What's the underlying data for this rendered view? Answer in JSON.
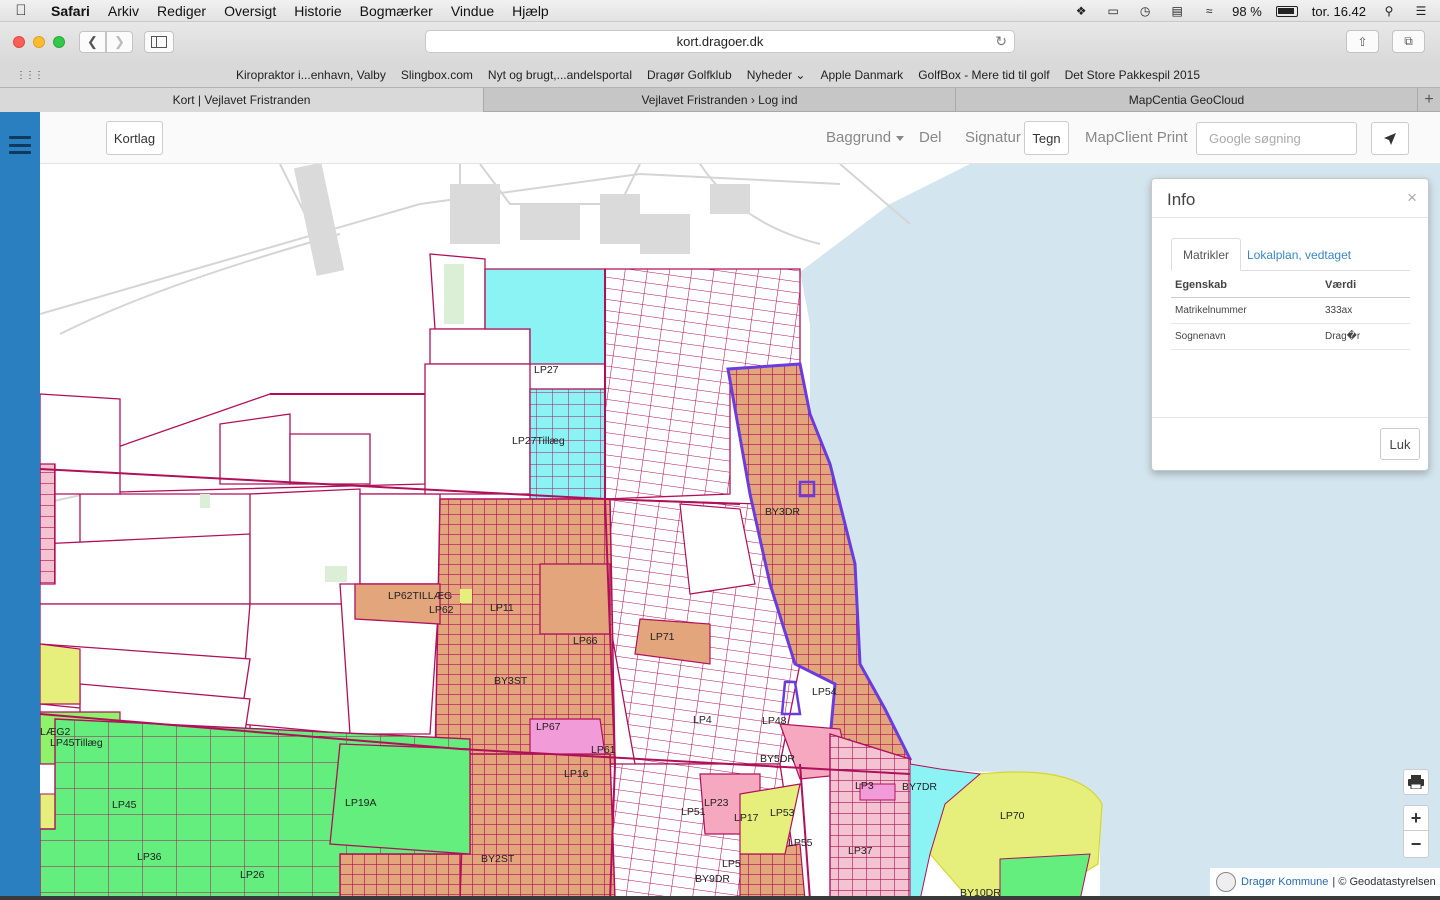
{
  "menubar": {
    "app": "Safari",
    "items": [
      "Arkiv",
      "Rediger",
      "Oversigt",
      "Historie",
      "Bogmærker",
      "Vindue",
      "Hjælp"
    ],
    "battery": "98 %",
    "clock": "tor. 16.42"
  },
  "browser": {
    "url": "kort.dragoer.dk",
    "bookmarks": [
      "Kiropraktor i...enhavn, Valby",
      "Slingbox.com",
      "Nyt og brugt,...andelsportal",
      "Dragør Golfklub",
      "Nyheder",
      "Apple Danmark",
      "GolfBox - Mere tid til golf",
      "Det Store Pakkespil 2015"
    ],
    "tabs": [
      "Kort | Vejlavet Fristranden",
      "Vejlavet Fristranden › Log ind",
      "MapCentia GeoCloud"
    ]
  },
  "header": {
    "kortlag": "Kortlag",
    "baggrund": "Baggrund",
    "del": "Del",
    "signatur": "Signatur",
    "tegn": "Tegn",
    "print": "MapClient Print",
    "search_placeholder": "Google søgning"
  },
  "info": {
    "title": "Info",
    "close": "×",
    "tab_active": "Matrikler",
    "tab_other": "Lokalplan, vedtaget",
    "col_property": "Egenskab",
    "col_value": "Værdi",
    "rows": [
      {
        "key": "Matrikelnummer",
        "value": "333ax"
      },
      {
        "key": "Sognenavn",
        "value": "Drag�r"
      }
    ],
    "button": "Luk"
  },
  "map": {
    "labels": [
      "LP27",
      "LP27Tillæg",
      "BY3DR",
      "LP62TILLÆG",
      "LP62",
      "LP11",
      "LP66",
      "LP71",
      "BY3ST",
      "LP54",
      "LP4",
      "LP48",
      "LP67",
      "LP61",
      "BY5DR",
      "LÆG2",
      "LP45Tillæg",
      "LP45",
      "LP19A",
      "LP16",
      "LP3",
      "BY7DR",
      "LP51",
      "LP23",
      "LP17",
      "LP53",
      "LP70",
      "LP36",
      "BY2ST",
      "LP55",
      "LP37",
      "LP5",
      "LP26",
      "BY9DR",
      "BY10DR"
    ],
    "zoom_in": "+",
    "zoom_out": "−",
    "attribution_link": "Dragør Kommune",
    "attribution_text": "| © Geodatastyrelsen"
  },
  "colors": {
    "sidebar": "#2a7fc1",
    "sea": "#d3e5ee",
    "parcel_line": "#b0105a",
    "orange": "#e2a57c",
    "pink": "#f5a8bf",
    "cyan": "#8cf3f5",
    "green": "#63ee7e",
    "yellow": "#e7ef7c",
    "selection": "#6a3ce0"
  }
}
